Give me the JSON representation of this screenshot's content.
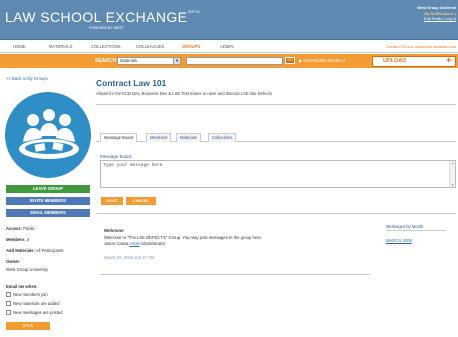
{
  "header": {
    "title": "LAW SCHOOL EXCHANGE",
    "beta": "BETA",
    "subtitle": "POWERED BY WEST",
    "user_name": "West Group Universit",
    "notifications": "My Notifications (",
    "edit_profile": "Edit Profile | Log ot"
  },
  "nav": {
    "items": [
      "HOME",
      "MATERIALS",
      "COLLECTIONS",
      "COLLEAGUES",
      "GROUPS",
      "ADMIN"
    ],
    "active": "GROUPS",
    "right_links": "Create Ext Link   lawschool.westlaw.com"
  },
  "search": {
    "label": "SEARCH",
    "select_value": "Materials",
    "go_label": "GO",
    "advanced_label": "▶ ADVANCED SEARCH",
    "upload_label": "UPLOAD"
  },
  "sidebar": {
    "back_link": "<< Back to My Groups",
    "leave_group": "LEAVE GROUP",
    "invite_members": "INVITE MEMBERS",
    "email_members": "EMAIL MEMBERS",
    "access_label": "Access:",
    "access_value": "Public",
    "members_label": "Members:",
    "members_value": "4",
    "add_materials_label": "Add Materials:",
    "add_materials_value": "All Participants",
    "owner_label": "Owner:",
    "owner_value": "West Group University",
    "email_me_label": "Email me when:",
    "checkboxes": [
      "New members join",
      "New materials are added",
      "New messages are posted"
    ],
    "save_label": "SAVE"
  },
  "main": {
    "title": "Contract Law 101",
    "description": "Allows for the KCB Dev, Business Dev & LSE Test teams to raise and discuss LSE site Defects",
    "tabs": [
      "Message Board",
      "Members",
      "Materials",
      "Collections"
    ],
    "active_tab": "Message Board",
    "message_board_label": "Message Board",
    "textarea_value": "Type your message here",
    "post_label": "POST",
    "cancel_label": "CANCEL"
  },
  "post": {
    "title": "Welcome",
    "body_line1": "Welcome to \"The LSE DEFECT's\" Group. You may post messages to the group here.",
    "author": "Jason Cassa",
    "email_link": "email",
    "author_role": "Administrator",
    "date": "March 20, 2008  at 6:47 AM"
  },
  "archive": {
    "title": "Messages by Month",
    "month": "MARCH 2008"
  },
  "colors": {
    "header_blue": "#5e8ab2",
    "accent_orange": "#f39c33",
    "link_blue": "#2b6cb0",
    "leave_green": "#3d9b3d",
    "action_blue": "#4f78b8"
  }
}
